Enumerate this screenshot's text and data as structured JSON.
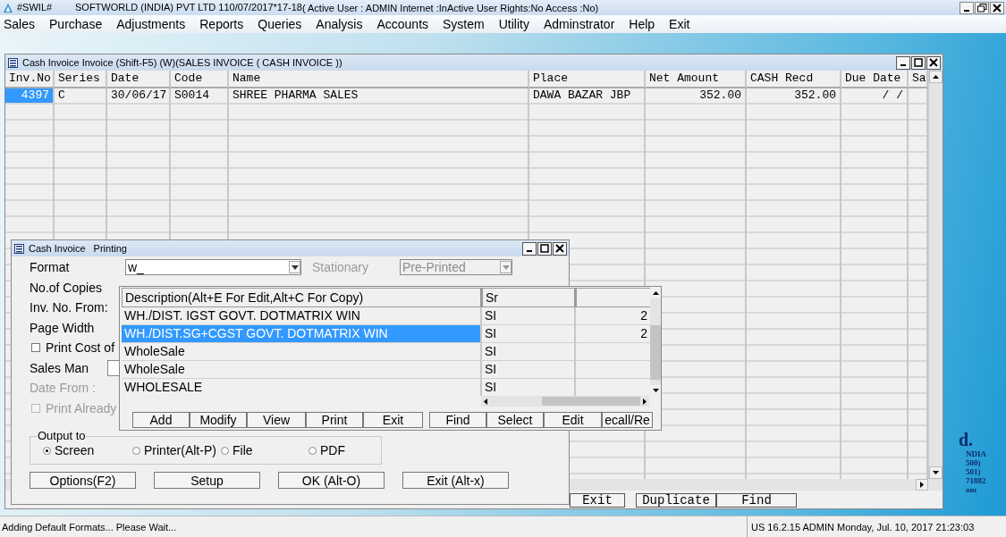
{
  "app_title_bar": {
    "app_name": "#SWIL#",
    "company": "SOFTWORLD (INDIA) PVT LTD 1",
    "date": "10/07/2017*17-18",
    "session": "( Active User : ADMIN Internet :InActive User Rights:No Access :No)"
  },
  "menu": [
    "Sales",
    "Purchase",
    "Adjustments",
    "Reports",
    "Queries",
    "Analysis",
    "Accounts",
    "System",
    "Utility",
    "Adminstrator",
    "Help",
    "Exit"
  ],
  "wallpaper_text": [
    "d.",
    "NDIA",
    "500)",
    "501)",
    "71882",
    "om"
  ],
  "invoice_window": {
    "title": "Cash Invoice Invoice (Shift-F5) (W)(SALES INVOICE ( CASH INVOICE ))",
    "columns": [
      "Inv.No",
      "Series",
      "Date",
      "Code",
      "Name",
      "Place",
      "Net Amount",
      "CASH Recd",
      "Due Date",
      "Sa"
    ],
    "rows": [
      {
        "cells": [
          "4397",
          "C",
          "30/06/17",
          "S0014",
          "SHREE PHARMA SALES",
          "DAWA BAZAR JBP",
          "352.00",
          "352.00",
          "/  /",
          ""
        ],
        "selected": true
      }
    ],
    "buttons": [
      "Exit",
      "Duplicate",
      "Find"
    ]
  },
  "print_dialog": {
    "title": "Cash Invoice",
    "subtitle": "Printing",
    "format": {
      "label": "Format",
      "value": "w_"
    },
    "stationary": {
      "label": "Stationary",
      "value": "Pre-Printed",
      "disabled": true
    },
    "rows": [
      {
        "kind": "text",
        "label": "No.of Copies",
        "disabled": false
      },
      {
        "kind": "text",
        "label": "Inv. No. From:",
        "disabled": false
      },
      {
        "kind": "text",
        "label": "Page Width",
        "disabled": false
      },
      {
        "kind": "checkbox",
        "label": "Print Cost of",
        "checked": false,
        "disabled": false
      },
      {
        "kind": "field",
        "label": "Sales Man",
        "disabled": false
      },
      {
        "kind": "text",
        "label": "Date From :",
        "disabled": true
      },
      {
        "kind": "checkbox",
        "label": "Print Already",
        "checked": false,
        "disabled": true
      }
    ],
    "output": {
      "label": "Output to",
      "options": [
        {
          "label": "Screen",
          "selected": true
        },
        {
          "label": "Printer(Alt-P)",
          "selected": false
        },
        {
          "label": "File",
          "selected": false
        },
        {
          "label": "PDF",
          "selected": false
        }
      ]
    },
    "buttons": [
      "Options(F2)",
      "Setup",
      "OK (Alt-O)",
      "Exit (Alt-x)"
    ]
  },
  "format_list": {
    "columns": [
      "Description(Alt+E For Edit,Alt+C For Copy)",
      "Sr",
      ""
    ],
    "rows": [
      {
        "cells": [
          "WH./DIST. IGST GOVT. DOTMATRIX WIN",
          "SI",
          "2"
        ],
        "selected": false
      },
      {
        "cells": [
          "WH./DIST.SG+CGST GOVT. DOTMATRIX WIN",
          "SI",
          "2"
        ],
        "selected": true
      },
      {
        "cells": [
          "WholeSale",
          "SI",
          ""
        ],
        "selected": false
      },
      {
        "cells": [
          "WholeSale",
          "SI",
          ""
        ],
        "selected": false
      },
      {
        "cells": [
          "WHOLESALE",
          "SI",
          ""
        ],
        "selected": false
      }
    ],
    "buttons": [
      "Add",
      "Modify",
      "View",
      "Print",
      "Exit",
      "Find",
      "Select",
      "Edit",
      "ecall/Re"
    ]
  },
  "status_bar": {
    "message": "Adding Default Formats... Please Wait...",
    "info": "US 16.2.15 ADMIN  Monday, Jul. 10, 2017  21:23:03"
  }
}
